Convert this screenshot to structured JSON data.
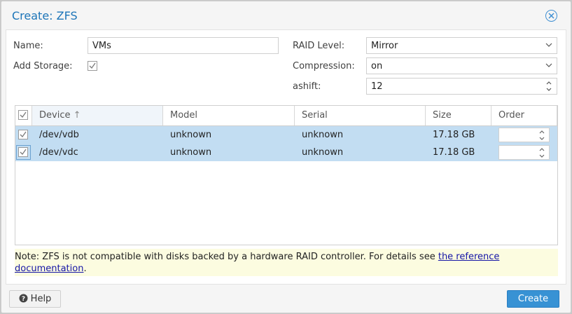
{
  "dialog": {
    "title": "Create: ZFS"
  },
  "form": {
    "name_label": "Name:",
    "name_value": "VMs",
    "add_storage_label": "Add Storage:",
    "add_storage_checked": true,
    "raid_label": "RAID Level:",
    "raid_value": "Mirror",
    "compression_label": "Compression:",
    "compression_value": "on",
    "ashift_label": "ashift:",
    "ashift_value": "12"
  },
  "grid": {
    "columns": {
      "device": "Device",
      "model": "Model",
      "serial": "Serial",
      "size": "Size",
      "order": "Order"
    },
    "sort_indicator": "↑",
    "rows": [
      {
        "device": "/dev/vdb",
        "model": "unknown",
        "serial": "unknown",
        "size": "17.18 GB",
        "order": "",
        "checked": true
      },
      {
        "device": "/dev/vdc",
        "model": "unknown",
        "serial": "unknown",
        "size": "17.18 GB",
        "order": "",
        "checked": true
      }
    ]
  },
  "note": {
    "text": "Note: ZFS is not compatible with disks backed by a hardware RAID controller. For details see ",
    "link": "the reference documentation",
    "suffix": "."
  },
  "buttons": {
    "help": "Help",
    "create": "Create"
  },
  "colors": {
    "accent": "#3892d4",
    "title": "#1d75b8",
    "row_selected": "#c2ddf2",
    "note_bg": "#fcfce0"
  }
}
